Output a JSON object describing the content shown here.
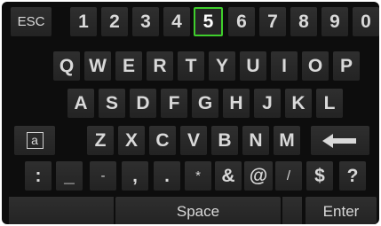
{
  "keyboard": {
    "row1": [
      "ESC",
      "1",
      "2",
      "3",
      "4",
      "5",
      "6",
      "7",
      "8",
      "9",
      "0"
    ],
    "row2": [
      "Q",
      "W",
      "E",
      "R",
      "T",
      "Y",
      "U",
      "I",
      "O",
      "P"
    ],
    "row3": [
      "A",
      "S",
      "D",
      "F",
      "G",
      "H",
      "J",
      "K",
      "L"
    ],
    "row4": [
      "a",
      "Z",
      "X",
      "C",
      "V",
      "B",
      "N",
      "M"
    ],
    "row5": [
      ":",
      "_",
      "-",
      ",",
      ".",
      "*",
      "&",
      "@",
      "/",
      "$",
      "?"
    ],
    "space_label": "Space",
    "enter_label": "Enter",
    "selected_key": "5",
    "backspace_icon": "left-arrow-icon",
    "highlight_color": "#3fcf2c"
  }
}
